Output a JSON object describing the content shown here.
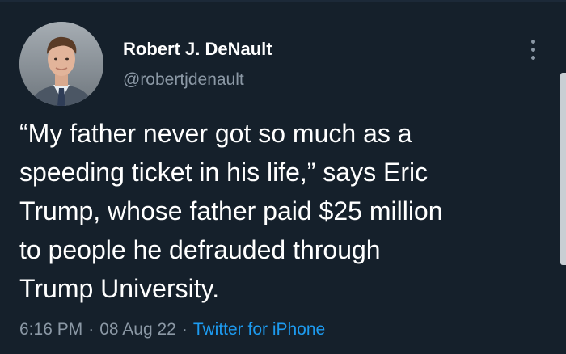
{
  "author": {
    "name": "Robert J. DeNault",
    "handle": "@robertjdenault"
  },
  "tweet": {
    "lines": [
      "“My father never got so much as a",
      "speeding ticket in his life,” says Eric",
      "Trump, whose father paid $25 million",
      "to people he defrauded through",
      "Trump University."
    ]
  },
  "meta": {
    "time": "6:16 PM",
    "separator": "·",
    "date": "08 Aug 22",
    "source": "Twitter for iPhone"
  },
  "icons": {
    "more": "more-vertical-icon"
  },
  "colors": {
    "background": "#15202b",
    "text": "#ffffff",
    "muted": "#8b98a5",
    "link": "#1d9bf0"
  }
}
